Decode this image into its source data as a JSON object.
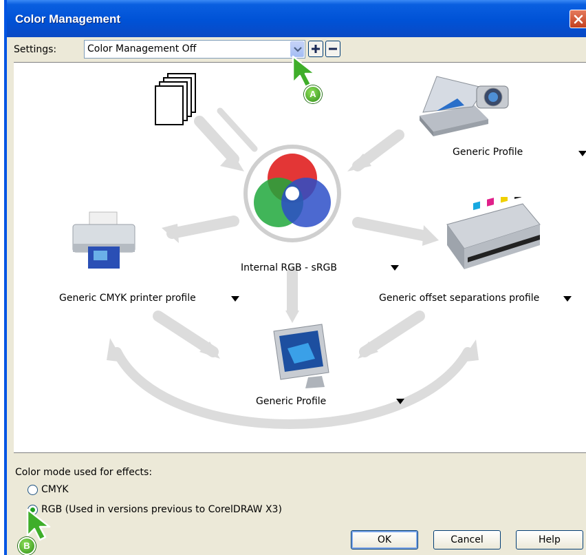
{
  "window": {
    "title": "Color Management",
    "close_icon": "close-icon"
  },
  "settings": {
    "label": "Settings:",
    "selected": "Color Management Off",
    "add_icon": "plus-icon",
    "remove_icon": "minus-icon"
  },
  "diagram": {
    "scanner_profile": "Generic Profile",
    "internal_profile": "Internal RGB - sRGB",
    "printer_profile": "Generic CMYK printer profile",
    "offset_profile": "Generic offset separations profile",
    "monitor_profile": "Generic Profile",
    "dropdown_icon": "triangle-down-icon"
  },
  "effects": {
    "label": "Color mode used for effects:",
    "options": [
      "CMYK",
      "RGB (Used in versions previous to CorelDRAW X3)"
    ],
    "selected_index": 1
  },
  "buttons": {
    "ok": "OK",
    "cancel": "Cancel",
    "help": "Help"
  },
  "callouts": {
    "a": "A",
    "b": "B"
  },
  "colors": {
    "titlebar": "#0052d6",
    "dialog_bg": "#ece9d8",
    "callout_green": "#3fae2a"
  }
}
